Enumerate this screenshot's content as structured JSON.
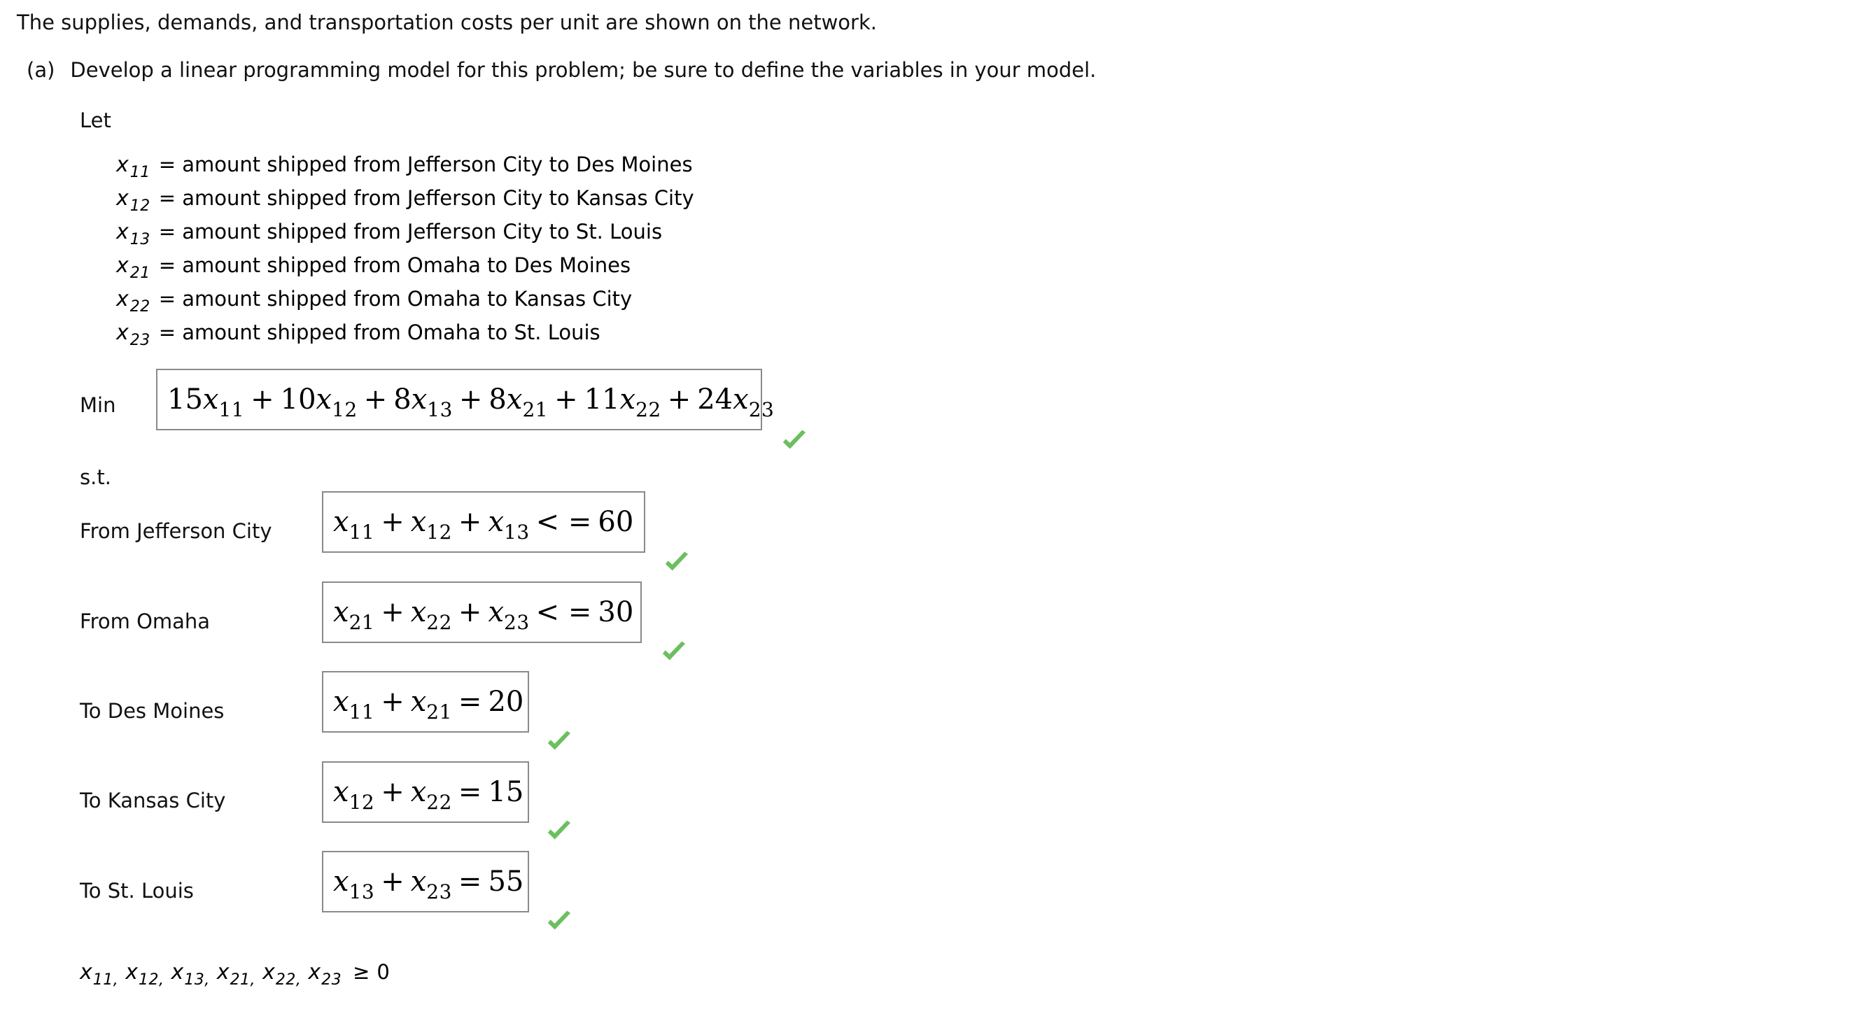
{
  "intro": {
    "text": "The supplies, demands, and transportation costs per unit are shown on the network."
  },
  "part_a": {
    "label": "(a)",
    "text": "Develop a linear programming model for this problem; be sure to define the variables in your model.",
    "let_label": "Let"
  },
  "variables": [
    {
      "symbol": "x",
      "subscript": "11",
      "equals": "=",
      "description": "amount shipped from Jefferson City to Des Moines"
    },
    {
      "symbol": "x",
      "subscript": "12",
      "equals": "=",
      "description": "amount shipped from Jefferson City to Kansas City"
    },
    {
      "symbol": "x",
      "subscript": "13",
      "equals": "=",
      "description": "amount shipped from Jefferson City to St. Louis"
    },
    {
      "symbol": "x",
      "subscript": "21",
      "equals": "=",
      "description": "amount shipped from Omaha to Des Moines"
    },
    {
      "symbol": "x",
      "subscript": "22",
      "equals": "=",
      "description": "amount shipped from Omaha to Kansas City"
    },
    {
      "symbol": "x",
      "subscript": "23",
      "equals": "=",
      "description": "amount shipped from Omaha to St. Louis"
    }
  ],
  "objective": {
    "label": "Min",
    "terms": [
      {
        "coefficient": "15",
        "variable": "x",
        "subscript": "11",
        "operator": ""
      },
      {
        "coefficient": "10",
        "variable": "x",
        "subscript": "12",
        "operator": "+"
      },
      {
        "coefficient": "8",
        "variable": "x",
        "subscript": "13",
        "operator": "+"
      },
      {
        "coefficient": "8",
        "variable": "x",
        "subscript": "21",
        "operator": "+"
      },
      {
        "coefficient": "11",
        "variable": "x",
        "subscript": "22",
        "operator": "+"
      },
      {
        "coefficient": "24",
        "variable": "x",
        "subscript": "23",
        "operator": "+"
      }
    ],
    "status": "correct"
  },
  "subject_to_label": "s.t.",
  "constraints": [
    {
      "label": "From Jefferson City",
      "terms": [
        {
          "variable": "x",
          "subscript": "11",
          "operator": ""
        },
        {
          "variable": "x",
          "subscript": "12",
          "operator": "+"
        },
        {
          "variable": "x",
          "subscript": "13",
          "operator": "+"
        }
      ],
      "relation": "< =",
      "rhs": "60",
      "status": "correct"
    },
    {
      "label": "From Omaha",
      "terms": [
        {
          "variable": "x",
          "subscript": "21",
          "operator": ""
        },
        {
          "variable": "x",
          "subscript": "22",
          "operator": "+"
        },
        {
          "variable": "x",
          "subscript": "23",
          "operator": "+"
        }
      ],
      "relation": "< =",
      "rhs": "30",
      "status": "correct"
    },
    {
      "label": "To Des Moines",
      "terms": [
        {
          "variable": "x",
          "subscript": "11",
          "operator": ""
        },
        {
          "variable": "x",
          "subscript": "21",
          "operator": "+"
        }
      ],
      "relation": "=",
      "rhs": "20",
      "status": "correct"
    },
    {
      "label": "To Kansas City",
      "terms": [
        {
          "variable": "x",
          "subscript": "12",
          "operator": ""
        },
        {
          "variable": "x",
          "subscript": "22",
          "operator": "+"
        }
      ],
      "relation": "=",
      "rhs": "15",
      "status": "correct"
    },
    {
      "label": "To St. Louis",
      "terms": [
        {
          "variable": "x",
          "subscript": "13",
          "operator": ""
        },
        {
          "variable": "x",
          "subscript": "23",
          "operator": "+"
        }
      ],
      "relation": "=",
      "rhs": "55",
      "status": "correct"
    }
  ],
  "non_negativity": {
    "variables": [
      {
        "symbol": "x",
        "subscript": "11",
        "separator": ","
      },
      {
        "symbol": "x",
        "subscript": "12",
        "separator": ","
      },
      {
        "symbol": "x",
        "subscript": "13",
        "separator": ","
      },
      {
        "symbol": "x",
        "subscript": "21",
        "separator": ","
      },
      {
        "symbol": "x",
        "subscript": "22",
        "separator": ","
      },
      {
        "symbol": "x",
        "subscript": "23",
        "separator": ""
      }
    ],
    "relation": "≥",
    "rhs": "0"
  },
  "colors": {
    "check_green": "#6cbf5f",
    "box_border": "#8a8a8a",
    "text": "#111111"
  }
}
